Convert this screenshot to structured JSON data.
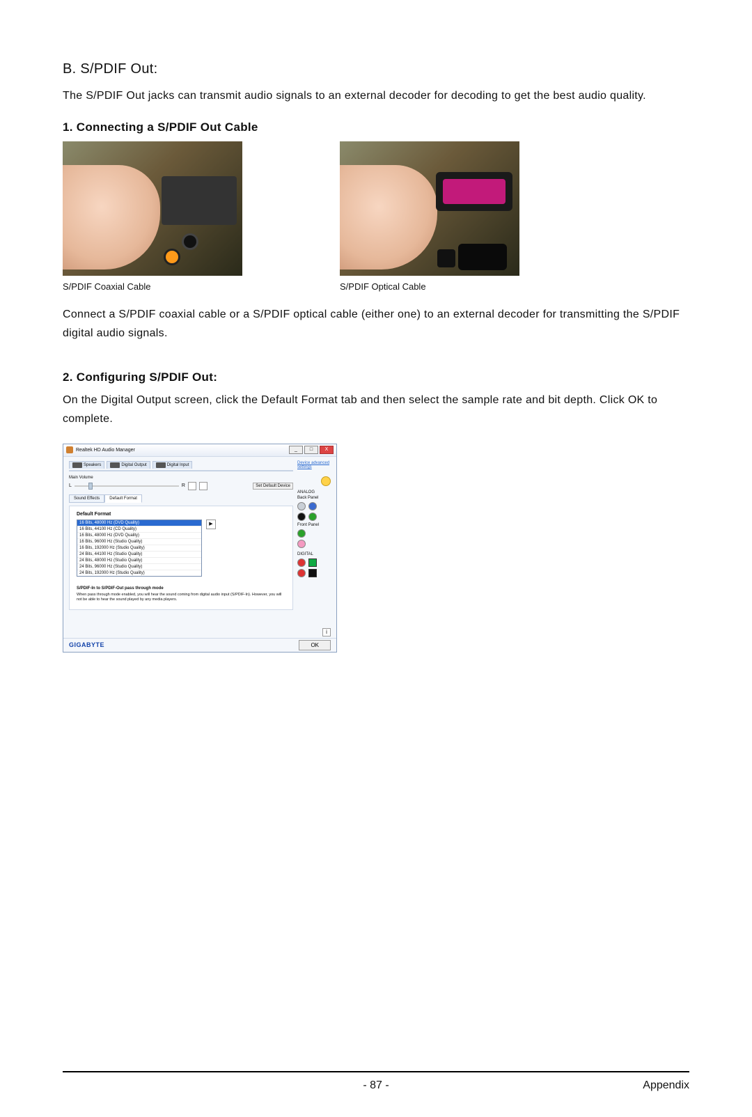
{
  "section": {
    "title": "B. S/PDIF Out:",
    "intro": "The S/PDIF Out jacks can transmit audio signals to an external decoder for decoding to get the best audio quality."
  },
  "step1": {
    "title": "1. Connecting a S/PDIF Out Cable",
    "caption_left": "S/PDIF Coaxial Cable",
    "caption_right": "S/PDIF Optical Cable",
    "desc": "Connect a S/PDIF coaxial cable or a S/PDIF optical cable (either one) to an external decoder for transmitting the S/PDIF digital audio signals."
  },
  "step2": {
    "title": "2. Configuring S/PDIF Out:",
    "desc_pre": "On the ",
    "desc_digital_output": "Digital Output",
    "desc_mid1": " screen, click the ",
    "desc_default_format": "Default Format",
    "desc_mid2": " tab and then select the sample rate and bit depth. Click ",
    "desc_ok": "OK",
    "desc_post": " to complete."
  },
  "window": {
    "title": "Realtek HD Audio Manager",
    "close": "X",
    "min": "_",
    "max": "□",
    "tabs": {
      "speakers": "Speakers",
      "digital_output": "Digital Output",
      "digital_input": "Digital Input"
    },
    "main_volume_label": "Main Volume",
    "vol_left": "L",
    "vol_right": "R",
    "set_default_btn": "Set Default Device",
    "subtabs": {
      "sound_effects": "Sound Effects",
      "default_format": "Default Format"
    },
    "panel_heading": "Default Format",
    "selected_format": "16 Bits, 48000 Hz (DVD Quality)",
    "options": [
      "16 Bits, 44100 Hz (CD Quality)",
      "16 Bits, 48000 Hz (DVD Quality)",
      "16 Bits, 96000 Hz (Studio Quality)",
      "16 Bits, 192000 Hz (Studio Quality)",
      "24 Bits, 44100 Hz (Studio Quality)",
      "24 Bits, 48000 Hz (Studio Quality)",
      "24 Bits, 96000 Hz (Studio Quality)",
      "24 Bits, 192000 Hz (Studio Quality)"
    ],
    "passthrough_heading": "S/PDIF-In to S/PDIF-Out pass through mode",
    "passthrough_text": "When pass through mode enabled, you will hear the sound coming from digital audio input (S/PDIF-In). However, you will not be able to hear the sound played by any media players.",
    "right": {
      "advanced_link": "Device advanced settings",
      "analog_label": "ANALOG",
      "back_panel_label": "Back Panel",
      "front_panel_label": "Front Panel",
      "digital_label": "DIGITAL"
    },
    "footer": {
      "brand": "GIGABYTE",
      "ok": "OK",
      "info": "i"
    }
  },
  "footer": {
    "page": "- 87 -",
    "section": "Appendix"
  }
}
